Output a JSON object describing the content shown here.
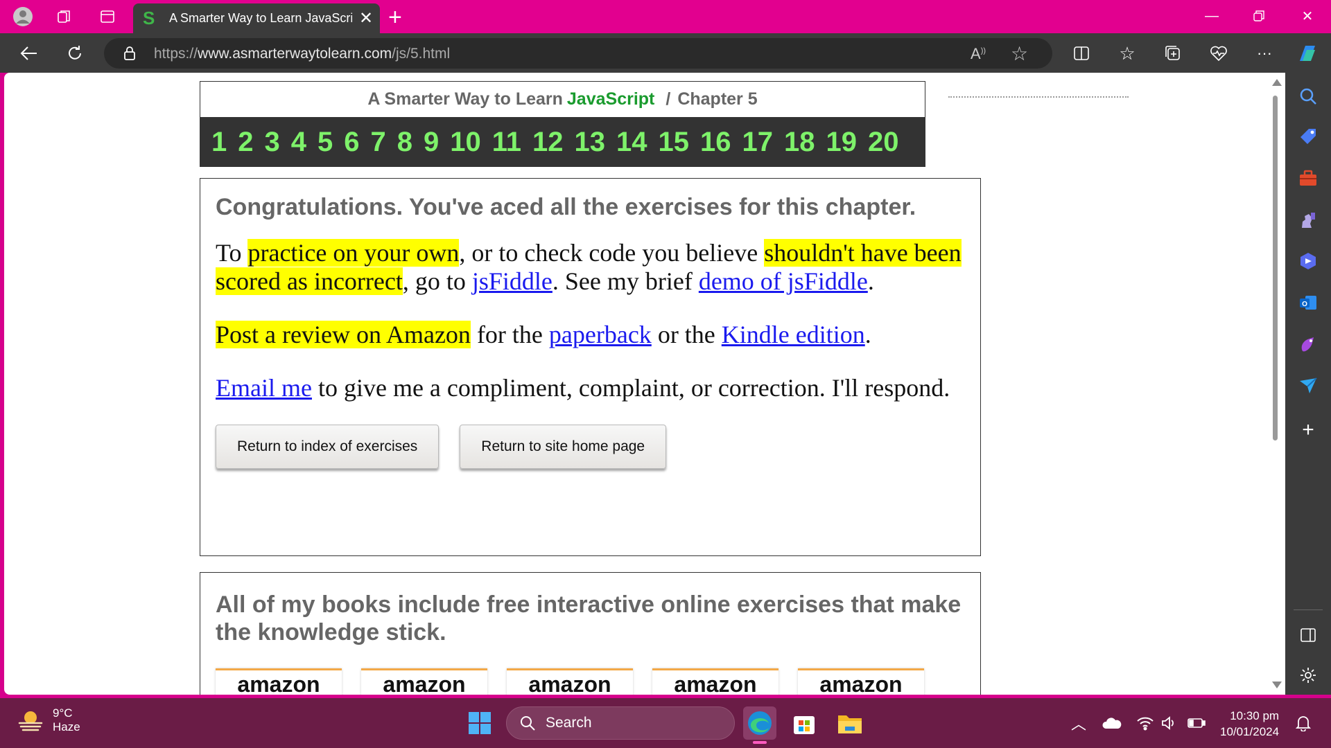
{
  "browser": {
    "tab_title": "A Smarter Way to Learn JavaScrip",
    "tab_favicon": "S",
    "url_prefix": "https://",
    "url_main": "www.asmarterwaytolearn.com",
    "url_path": "/js/5.html"
  },
  "header": {
    "title_part1": "A Smarter Way to Learn",
    "title_js": "JavaScript",
    "title_sep": "/",
    "title_chapter": "Chapter 5",
    "chapters": [
      "1",
      "2",
      "3",
      "4",
      "5",
      "6",
      "7",
      "8",
      "9",
      "10",
      "11",
      "12",
      "13",
      "14",
      "15",
      "16",
      "17",
      "18",
      "19",
      "20"
    ]
  },
  "congrats": {
    "heading": "Congratulations. You've aced all the exercises for this chapter.",
    "p1_a": "To ",
    "p1_hl1": "practice on your own",
    "p1_b": ", or to check code you believe ",
    "p1_hl2": "shouldn't have been scored as incorrect",
    "p1_c": ", go to ",
    "p1_link1": "jsFiddle",
    "p1_d": ". See my brief ",
    "p1_link2": "demo of jsFiddle",
    "p1_e": ".",
    "p2_hl": "Post a review on Amazon",
    "p2_a": " for the ",
    "p2_link1": "paperback",
    "p2_b": " or the ",
    "p2_link2": "Kindle edition",
    "p2_c": ".",
    "p3_link": "Email me",
    "p3_a": " to give me a compliment, complaint, or correction. I'll respond.",
    "btn_index": "Return to index of exercises",
    "btn_home": "Return to site home page"
  },
  "books": {
    "heading": "All of my books include free interactive online exercises that make the knowledge stick.",
    "logos": [
      "amazon",
      "amazon",
      "amazon",
      "amazon",
      "amazon"
    ]
  },
  "taskbar": {
    "temp": "9°C",
    "condition": "Haze",
    "search_placeholder": "Search",
    "time": "10:30 pm",
    "date": "10/01/2024"
  },
  "colors": {
    "titlebar": "#e2008f",
    "toolbar": "#3b3b3b",
    "chapter_bar": "#333333",
    "chapter_numbers": "#7ef26a",
    "js_green": "#1a9b2e",
    "highlight": "#ffff00",
    "link": "#1a1aee",
    "taskbar": "#6a1c46"
  }
}
